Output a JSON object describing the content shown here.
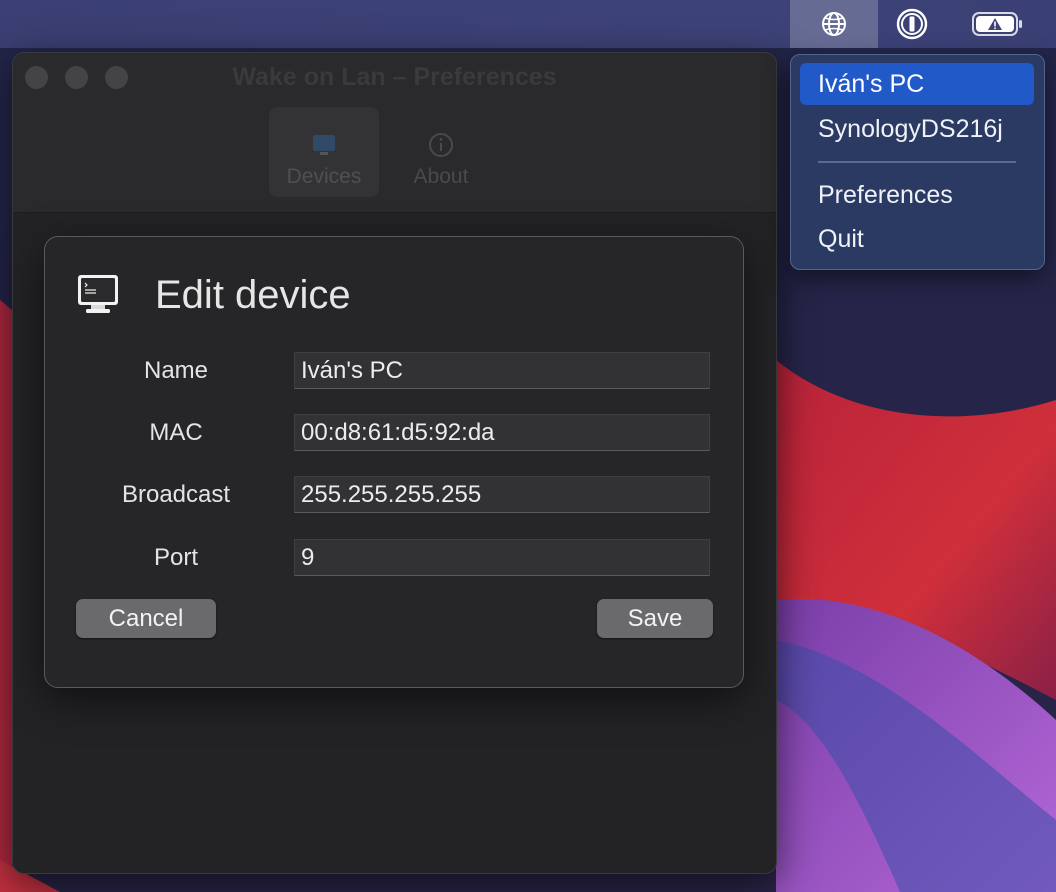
{
  "menubar": {
    "icons": [
      "globe-icon",
      "1password-icon",
      "battery-warning-icon"
    ]
  },
  "window": {
    "title": "Wake on Lan – Preferences",
    "tabs": [
      {
        "label": "Devices",
        "icon": "monitor-icon",
        "selected": true
      },
      {
        "label": "About",
        "icon": "info-icon",
        "selected": false
      }
    ]
  },
  "sheet": {
    "title": "Edit device",
    "icon": "computer-icon",
    "fields": {
      "name": {
        "label": "Name",
        "value": "Iván's PC"
      },
      "mac": {
        "label": "MAC",
        "value": "00:d8:61:d5:92:da"
      },
      "broadcast": {
        "label": "Broadcast",
        "value": "255.255.255.255"
      },
      "port": {
        "label": "Port",
        "value": "9"
      }
    },
    "cancel_label": "Cancel",
    "save_label": "Save"
  },
  "menu": {
    "devices": [
      "Iván's PC",
      "SynologyDS216j"
    ],
    "highlighted": "Iván's PC",
    "preferences_label": "Preferences",
    "quit_label": "Quit"
  },
  "colors": {
    "menu_highlight": "#2259c9",
    "button": "#6a6a6d",
    "window_bg": "#252528"
  }
}
